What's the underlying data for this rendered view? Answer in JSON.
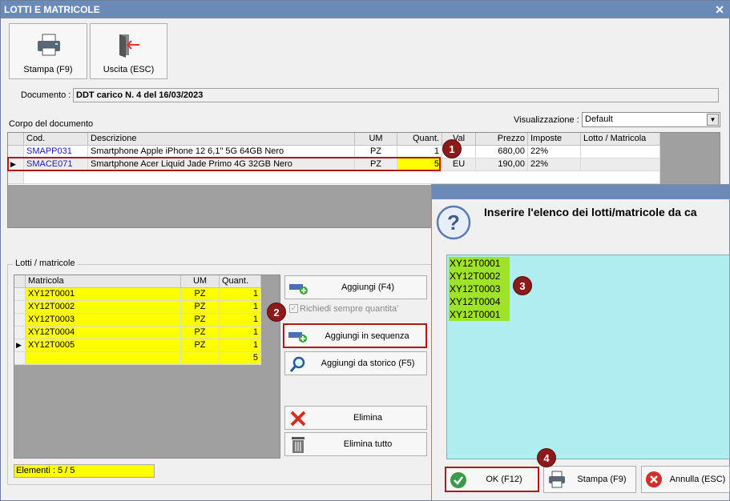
{
  "window": {
    "title": "LOTTI E MATRICOLE",
    "close_glyph": "✕"
  },
  "toolbar": {
    "print_label": "Stampa (F9)",
    "exit_label": "Uscita (ESC)"
  },
  "document": {
    "label": "Documento :",
    "value": "DDT carico N. 4 del 16/03/2023"
  },
  "view": {
    "label": "Visualizzazione :",
    "selected": "Default"
  },
  "body_section": {
    "label": "Corpo del documento"
  },
  "doc_table": {
    "headers": [
      "Cod.",
      "Descrizione",
      "UM",
      "Quant.",
      "Val",
      "Prezzo",
      "Imposte",
      "Lotto / Matricola"
    ],
    "rows": [
      {
        "code": "SMAPP031",
        "desc": "Smartphone Apple iPhone 12 6,1\" 5G 64GB Nero",
        "um": "PZ",
        "qty": "1",
        "val": "",
        "price": "680,00",
        "tax": "22%",
        "lot": ""
      },
      {
        "code": "SMACE071",
        "desc": "Smartphone Acer Liquid Jade Primo 4G 32GB Nero",
        "um": "PZ",
        "qty": "5",
        "val": "EU",
        "price": "190,00",
        "tax": "22%",
        "lot": ""
      }
    ]
  },
  "lots_section": {
    "label": "Lotti / matricole"
  },
  "lots_table": {
    "headers": [
      "Matricola",
      "UM",
      "Quant."
    ],
    "rows": [
      {
        "serial": "XY12T0001",
        "um": "PZ",
        "qty": "1"
      },
      {
        "serial": "XY12T0002",
        "um": "PZ",
        "qty": "1"
      },
      {
        "serial": "XY12T0003",
        "um": "PZ",
        "qty": "1"
      },
      {
        "serial": "XY12T0004",
        "um": "PZ",
        "qty": "1"
      },
      {
        "serial": "XY12T0005",
        "um": "PZ",
        "qty": "1"
      }
    ],
    "total": "5"
  },
  "actions": {
    "add": "Aggiungi (F4)",
    "ask_qty": "Richiedi sempre quantita'",
    "add_seq": "Aggiungi in sequenza",
    "add_history": "Aggiungi da storico (F5)",
    "delete": "Elimina",
    "delete_all": "Elimina tutto"
  },
  "elements": "Elementi : 5 / 5",
  "dialog": {
    "message": "Inserire l'elenco dei lotti/matricole da ca",
    "lines": [
      "XY12T0001",
      "XY12T0002",
      "XY12T0003",
      "XY12T0004",
      "XY12T0001"
    ],
    "ok": "OK (F12)",
    "print": "Stampa (F9)",
    "cancel": "Annulla (ESC)"
  },
  "markers": [
    "1",
    "2",
    "3",
    "4"
  ],
  "colors": {
    "titlebar": "#6b8ab8",
    "highlight": "#ffff00",
    "memo_bg": "#aeeef0",
    "memo_line": "#9ee22a",
    "marker": "#8b1a1a",
    "link": "#1a1aaa"
  }
}
